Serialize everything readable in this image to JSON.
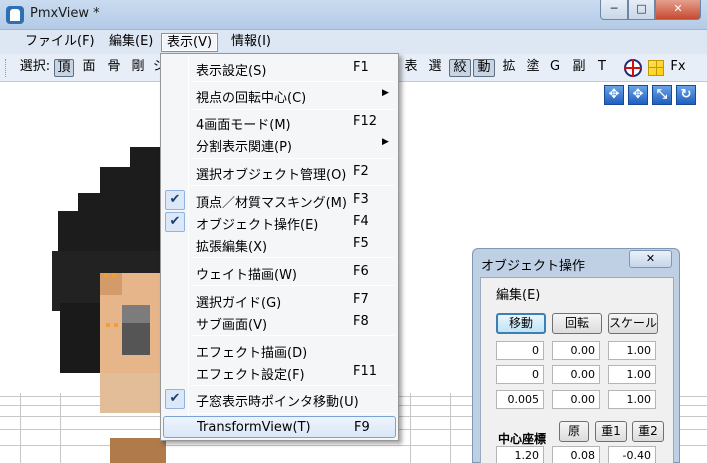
{
  "window": {
    "title": "PmxView *",
    "min": "─",
    "max": "□",
    "close": "✕"
  },
  "menubar": {
    "file": "ファイル(F)",
    "edit": "編集(E)",
    "view": "表示(V)",
    "info": "情報(I)"
  },
  "toolbar": {
    "select_label": "選択:",
    "left_items": [
      "頂",
      "面",
      "骨",
      "剛",
      "ジ"
    ],
    "right_items": [
      "表",
      "選",
      "絞",
      "動",
      "拡",
      "塗",
      "G",
      "副",
      "T"
    ],
    "pressed": [
      "頂",
      "絞",
      "動"
    ],
    "fx": "Fx"
  },
  "view_menu": {
    "items": [
      {
        "label": "表示設定(S)",
        "key": "F1",
        "checked": false,
        "submenu": false
      },
      {
        "label": "視点の回転中心(C)",
        "key": "",
        "checked": false,
        "submenu": true
      },
      {
        "label": "4画面モード(M)",
        "key": "F12",
        "checked": false,
        "submenu": false
      },
      {
        "label": "分割表示関連(P)",
        "key": "",
        "checked": false,
        "submenu": true
      },
      {
        "label": "選択オブジェクト管理(O)",
        "key": "F2",
        "checked": false,
        "submenu": false
      },
      {
        "label": "頂点／材質マスキング(M)",
        "key": "F3",
        "checked": true,
        "submenu": false
      },
      {
        "label": "オブジェクト操作(E)",
        "key": "F4",
        "checked": true,
        "submenu": false
      },
      {
        "label": "拡張編集(X)",
        "key": "F5",
        "checked": false,
        "submenu": false
      },
      {
        "label": "ウェイト描画(W)",
        "key": "F6",
        "checked": false,
        "submenu": false
      },
      {
        "label": "選択ガイド(G)",
        "key": "F7",
        "checked": false,
        "submenu": false
      },
      {
        "label": "サブ画面(V)",
        "key": "F8",
        "checked": false,
        "submenu": false
      },
      {
        "label": "エフェクト描画(D)",
        "key": "",
        "checked": false,
        "submenu": false
      },
      {
        "label": "エフェクト設定(F)",
        "key": "F11",
        "checked": false,
        "submenu": false
      },
      {
        "label": "子窓表示時ポインタ移動(U)",
        "key": "",
        "checked": true,
        "submenu": false
      },
      {
        "label": "TransformView(T)",
        "key": "F9",
        "checked": false,
        "submenu": false,
        "highlighted": true
      }
    ],
    "check_glyph": "✔",
    "arrow_glyph": "▶"
  },
  "object_panel": {
    "title": "オブジェクト操作",
    "close": "✕",
    "edit_label": "編集(E)",
    "buttons": {
      "move": "移動",
      "rotate": "回転",
      "scale": "スケール"
    },
    "rows": [
      [
        "0",
        "0.00",
        "1.00"
      ],
      [
        "0",
        "0.00",
        "1.00"
      ],
      [
        "0.005",
        "0.00",
        "1.00"
      ]
    ],
    "center_label": "中心座標",
    "center_buttons": {
      "origin": "原",
      "g1": "重1",
      "g2": "重2"
    },
    "center_values": [
      "1.20",
      "0.08",
      "-0.40"
    ]
  },
  "viewport_tools": [
    "move-xy",
    "move-xz",
    "move-z",
    "rotate"
  ],
  "colors": {
    "accent": "#3c7fb1",
    "hair": "#151515",
    "skin": "#e6b68a",
    "close": "#c74a30"
  }
}
